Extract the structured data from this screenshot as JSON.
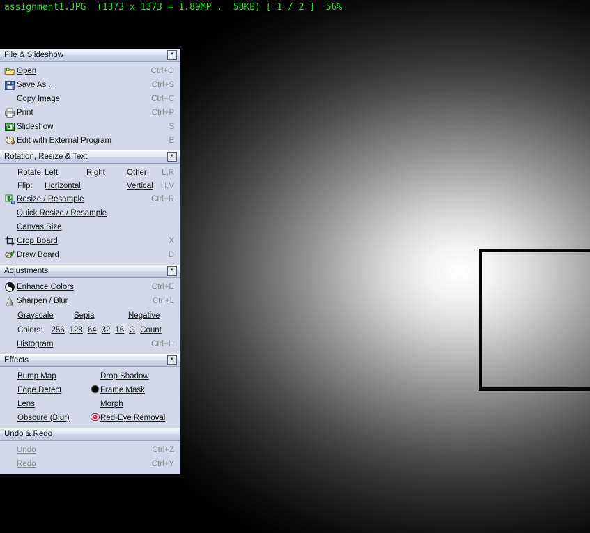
{
  "info_bar": {
    "text": "assignment1.JPG  (1373 x 1373 = 1.89MP ,  58KB) [ 1 / 2 ]  56%",
    "filename": "assignment1.JPG",
    "dimensions": "1373 x 1373",
    "megapixels": "1.89MP",
    "filesize": "58KB",
    "index": "[ 1 / 2 ]",
    "zoom": "56%",
    "color": "#2fd92f"
  },
  "image": {
    "type": "grayscale-radial-gradient",
    "selection_label": "frame-mask-selection"
  },
  "panel": {
    "collapse_glyph": "ʌ",
    "sections": [
      {
        "title": "File & Slideshow",
        "has_collapse": true,
        "rows": [
          {
            "icon": "open-folder-icon",
            "label": "Open",
            "shortcut": "Ctrl+O",
            "disabled": false
          },
          {
            "icon": "save-disk-icon",
            "label": "Save As ...",
            "shortcut": "Ctrl+S",
            "disabled": false
          },
          {
            "icon": "none",
            "label": "Copy Image",
            "shortcut": "Ctrl+C",
            "disabled": false
          },
          {
            "icon": "printer-icon",
            "label": "Print",
            "shortcut": "Ctrl+P",
            "disabled": false
          },
          {
            "icon": "slideshow-icon",
            "label": "Slideshow",
            "shortcut": "S",
            "disabled": false
          },
          {
            "icon": "palette-brush-icon",
            "label": "Edit with External Program",
            "shortcut": "E",
            "disabled": false
          }
        ]
      },
      {
        "title": "Rotation, Resize & Text",
        "has_collapse": true,
        "rotate": {
          "label": "Rotate:",
          "left": "Left",
          "right": "Right",
          "other": "Other",
          "shortcut": "L,R"
        },
        "flip": {
          "label": "Flip:",
          "horizontal": "Horizontal",
          "vertical": "Vertical",
          "shortcut": "H,V"
        },
        "rows": [
          {
            "icon": "resize-icon",
            "label": "Resize / Resample",
            "shortcut": "Ctrl+R",
            "disabled": false
          },
          {
            "icon": "none",
            "label": "Quick Resize / Resample",
            "shortcut": "",
            "disabled": false
          },
          {
            "icon": "none",
            "label": "Canvas Size",
            "shortcut": "",
            "disabled": false
          },
          {
            "icon": "crop-icon",
            "label": "Crop Board",
            "shortcut": "X",
            "disabled": false
          },
          {
            "icon": "draw-board-icon",
            "label": "Draw Board",
            "shortcut": "D",
            "disabled": false
          }
        ]
      },
      {
        "title": "Adjustments",
        "has_collapse": true,
        "rows": [
          {
            "icon": "contrast-circle-icon",
            "label": "Enhance Colors",
            "shortcut": "Ctrl+E",
            "disabled": false
          },
          {
            "icon": "sharpen-blur-icon",
            "label": "Sharpen / Blur",
            "shortcut": "Ctrl+L",
            "disabled": false
          }
        ],
        "tone_row": {
          "grayscale": "Grayscale",
          "sepia": "Sepia",
          "negative": "Negative"
        },
        "colors_row": {
          "label": "Colors:",
          "options": [
            "256",
            "128",
            "64",
            "32",
            "16",
            "G",
            "Count"
          ]
        },
        "histogram": {
          "label": "Histogram",
          "shortcut": "Ctrl+H"
        }
      },
      {
        "title": "Effects",
        "has_collapse": true,
        "grid": [
          {
            "left": "Bump Map",
            "left_icon": "none",
            "right": "Drop Shadow",
            "right_icon": "none"
          },
          {
            "left": "Edge Detect",
            "left_icon": "none",
            "right": "Frame Mask",
            "right_icon": "frame-mask-icon"
          },
          {
            "left": "Lens",
            "left_icon": "none",
            "right": "Morph",
            "right_icon": "none"
          },
          {
            "left": "Obscure (Blur)",
            "left_icon": "none",
            "right": "Red-Eye Removal",
            "right_icon": "red-eye-icon"
          }
        ]
      },
      {
        "title": "Undo & Redo",
        "has_collapse": false,
        "rows": [
          {
            "icon": "none",
            "label": "Undo",
            "shortcut": "Ctrl+Z",
            "disabled": true
          },
          {
            "icon": "none",
            "label": "Redo",
            "shortcut": "Ctrl+Y",
            "disabled": true
          }
        ]
      }
    ]
  }
}
